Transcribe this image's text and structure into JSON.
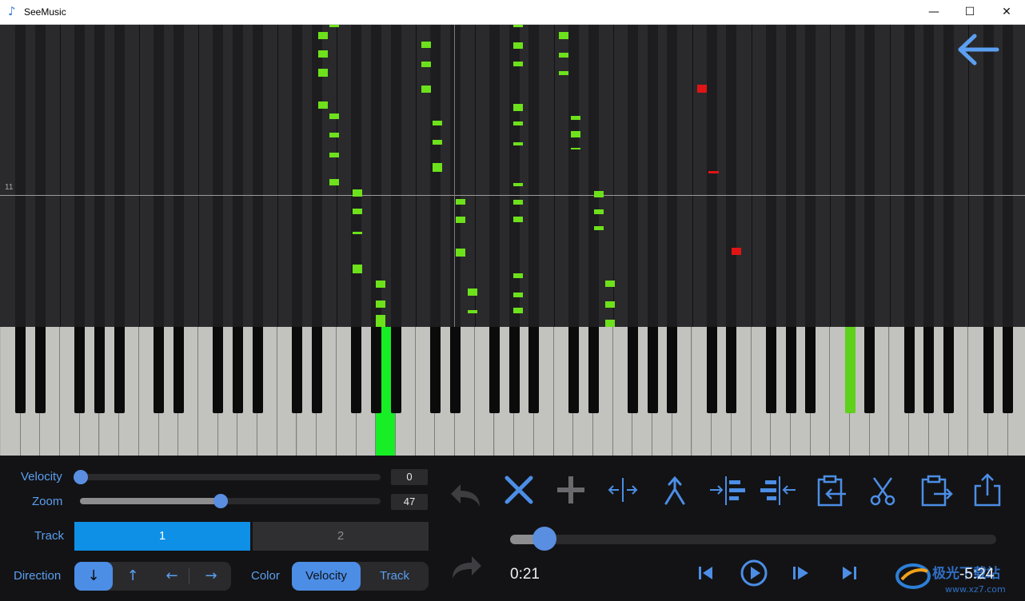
{
  "window": {
    "title": "SeeMusic",
    "icon": "music-note-icon"
  },
  "roll": {
    "measure_label": "11",
    "back_icon": "arrow-left-icon"
  },
  "controls": {
    "velocity": {
      "label": "Velocity",
      "value": "0"
    },
    "zoom": {
      "label": "Zoom",
      "value": "47",
      "level": 0.47
    },
    "track": {
      "label": "Track",
      "options": [
        "1",
        "2"
      ],
      "selected": "1"
    },
    "direction": {
      "label": "Direction",
      "options": [
        "↓",
        "↑",
        "←",
        "→"
      ],
      "selected": "↓"
    },
    "color": {
      "label": "Color",
      "options": [
        "Velocity",
        "Track"
      ],
      "selected": "Velocity"
    },
    "tools": [
      "delete-icon",
      "add-icon",
      "split-icon",
      "merge-icon",
      "align-right-icon",
      "align-left-icon",
      "paste-icon",
      "cut-icon",
      "copy-icon",
      "export-icon"
    ],
    "history": {
      "undo_icon": "undo-icon",
      "redo_icon": "redo-icon"
    }
  },
  "playback": {
    "current_time": "0:21",
    "remaining_time": "-5:24",
    "progress": 0.065,
    "buttons": [
      "skip-back-icon",
      "play-icon",
      "step-forward-icon",
      "skip-forward-icon"
    ]
  },
  "watermark": {
    "text": "极光下载站",
    "url": "www.xz7.com"
  },
  "colors": {
    "accent": "#5b9ff0",
    "note_green": "#6de11b",
    "note_red": "#e01414",
    "key_active": "#17ee25"
  }
}
